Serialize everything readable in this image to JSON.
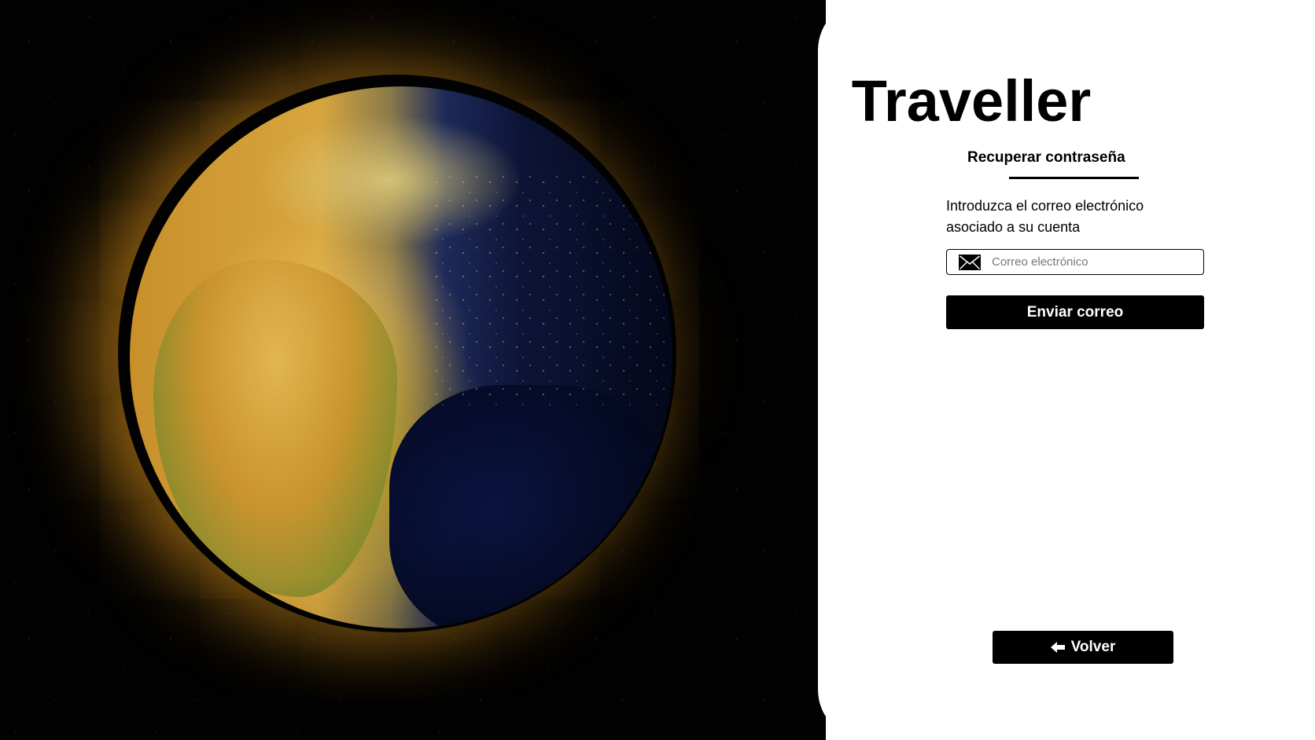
{
  "hero": {
    "image_description_name": "earth-image"
  },
  "app": {
    "title": "Traveller"
  },
  "recover": {
    "subtitle": "Recuperar contraseña",
    "instructions": "Introduzca el correo electrónico asociado a su cuenta",
    "email_placeholder": "Correo electrónico",
    "email_value": "",
    "send_label": "Enviar correo",
    "back_label": "Volver"
  },
  "icons": {
    "email": "envelope-icon",
    "back": "arrow-left-icon"
  },
  "colors": {
    "primary": "#000000",
    "background": "#ffffff",
    "space": "#020202"
  }
}
